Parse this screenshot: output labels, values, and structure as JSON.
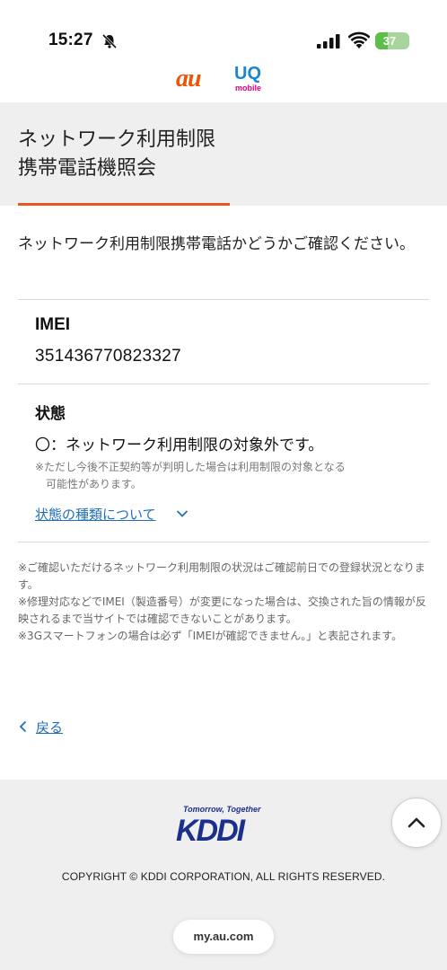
{
  "status_bar": {
    "time": "15:27",
    "battery": "37",
    "battery_level": 0.37
  },
  "logos": {
    "au": "au",
    "uq": "UQ",
    "uq_sub": "mobile"
  },
  "header": {
    "title": "ネットワーク利用制限\n携帯電話機照会"
  },
  "intro": "ネットワーク利用制限携帯電話かどうかご確認ください。",
  "imei": {
    "label": "IMEI",
    "value": "351436770823327"
  },
  "state": {
    "label": "状態",
    "result": "〇：ネットワーク利用制限の対象外です。",
    "note": "※ただし今後不正契約等が判明した場合は利用制限の対象となる\n　可能性があります。",
    "link": "状態の種類について"
  },
  "notes": [
    "※ご確認いただけるネットワーク利用制限の状況はご確認前日での登録状況となります。",
    "※修理対応などでIMEI（製造番号）が変更になった場合は、交換された旨の情報が反映されるまで当サイトでは確認できないことがあります。",
    "※3Gスマートフォンの場合は必ず「IMEIが確認できません。」と表記されます。"
  ],
  "back_label": "戻る",
  "footer": {
    "kddi_tagline": "Tomorrow, Together",
    "kddi_wordmark": "KDDI",
    "copyright": "COPYRIGHT © KDDI CORPORATION, ALL RIGHTS RESERVED."
  },
  "url": "my.au.com",
  "colors": {
    "accent": "#e8581c",
    "link": "#1f6fb8",
    "au": "#eb5505",
    "kddi": "#1c2f8a",
    "battery": "#5cbf4a"
  },
  "icons": [
    "silent-bell-icon",
    "cellular-signal-icon",
    "wifi-icon",
    "battery-icon",
    "chevron-down-icon",
    "chevron-left-icon",
    "chevron-up-icon"
  ]
}
